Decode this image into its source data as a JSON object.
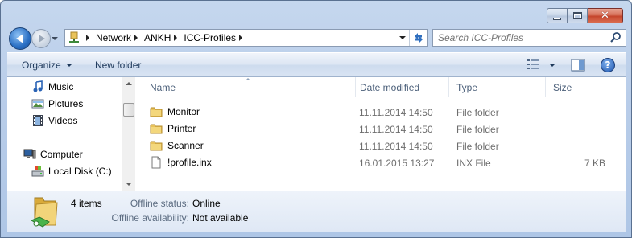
{
  "address_bar": {
    "crumbs": [
      "Network",
      "ANKH",
      "ICC-Profiles"
    ]
  },
  "search": {
    "placeholder": "Search ICC-Profiles"
  },
  "toolbar": {
    "organize_label": "Organize",
    "new_folder_label": "New folder"
  },
  "nav_pane": {
    "items": [
      {
        "label": "Music",
        "icon": "music-icon"
      },
      {
        "label": "Pictures",
        "icon": "pictures-icon"
      },
      {
        "label": "Videos",
        "icon": "videos-icon"
      },
      {
        "label": "Computer",
        "icon": "computer-icon"
      },
      {
        "label": "Local Disk (C:)",
        "icon": "disk-icon"
      }
    ]
  },
  "file_list": {
    "columns": {
      "name": "Name",
      "date": "Date modified",
      "type": "Type",
      "size": "Size"
    },
    "rows": [
      {
        "name": "Monitor",
        "date": "11.11.2014 14:50",
        "type": "File folder",
        "size": "",
        "icon": "folder-icon"
      },
      {
        "name": "Printer",
        "date": "11.11.2014 14:50",
        "type": "File folder",
        "size": "",
        "icon": "folder-icon"
      },
      {
        "name": "Scanner",
        "date": "11.11.2014 14:50",
        "type": "File folder",
        "size": "",
        "icon": "folder-icon"
      },
      {
        "name": "!profile.inx",
        "date": "16.01.2015 13:27",
        "type": "INX File",
        "size": "7 KB",
        "icon": "file-icon"
      }
    ]
  },
  "details": {
    "item_count": "4 items",
    "offline_status_label": "Offline status:",
    "offline_status_value": "Online",
    "offline_availability_label": "Offline availability:",
    "offline_availability_value": "Not available"
  },
  "colors": {
    "frame": "#b9cde9",
    "toolbar_text": "#1e395b",
    "folder": "#e8c25a",
    "close_button": "#c4432a"
  }
}
